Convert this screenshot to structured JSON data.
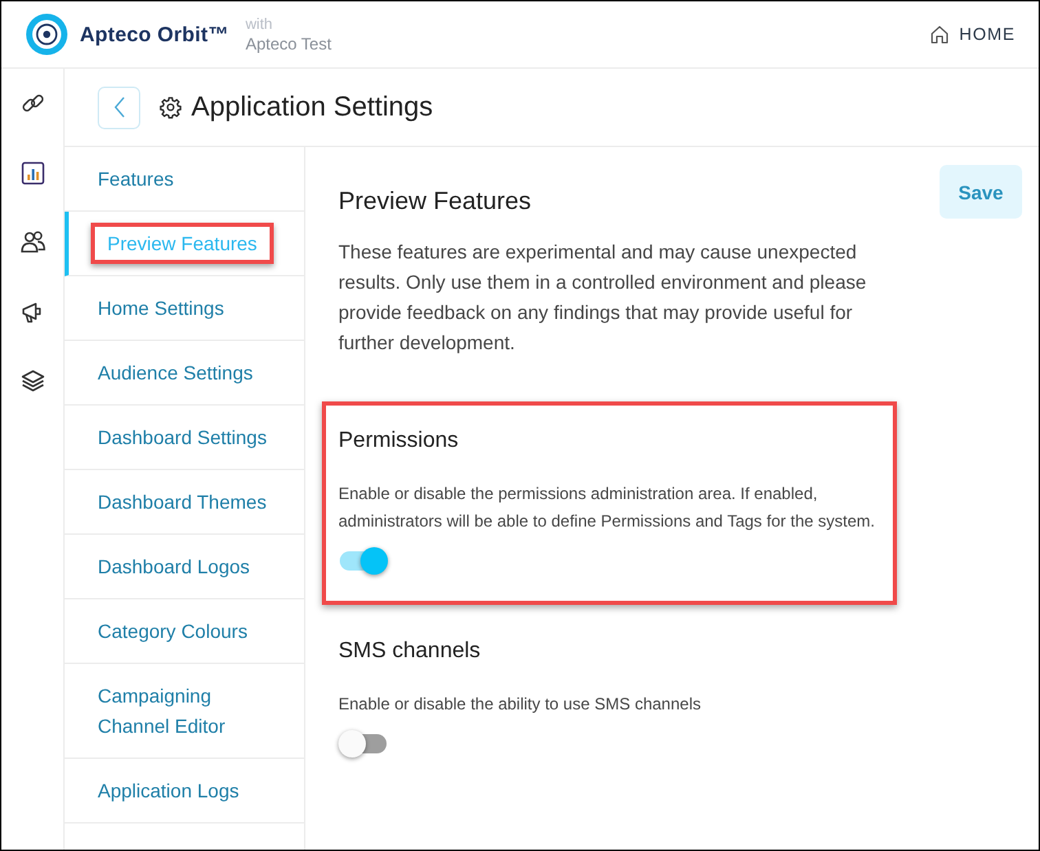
{
  "header": {
    "brand": "Apteco Orbit™",
    "with_label": "with",
    "workspace": "Apteco Test",
    "home_link": "HOME"
  },
  "page_header": {
    "title": "Application Settings"
  },
  "settings_nav": [
    {
      "label": "Features",
      "selected": false,
      "highlighted": false
    },
    {
      "label": "Preview Features",
      "selected": true,
      "highlighted": true
    },
    {
      "label": "Home Settings",
      "selected": false,
      "highlighted": false
    },
    {
      "label": "Audience Settings",
      "selected": false,
      "highlighted": false
    },
    {
      "label": "Dashboard Settings",
      "selected": false,
      "highlighted": false
    },
    {
      "label": "Dashboard Themes",
      "selected": false,
      "highlighted": false
    },
    {
      "label": "Dashboard Logos",
      "selected": false,
      "highlighted": false
    },
    {
      "label": "Category Colours",
      "selected": false,
      "highlighted": false
    },
    {
      "label": "Campaigning Channel Editor",
      "selected": false,
      "highlighted": false
    },
    {
      "label": "Application Logs",
      "selected": false,
      "highlighted": false
    }
  ],
  "content": {
    "title": "Preview Features",
    "description": "These features are experimental and may cause unexpected results. Only use them in a controlled environment and please provide feedback on any findings that may provide useful for further development.",
    "save_button": {
      "label": "Save",
      "disabled": true
    },
    "features": [
      {
        "title": "Permissions",
        "description": "Enable or disable the permissions administration area. If enabled, administrators will be able to define Permissions and Tags for the system.",
        "on": true,
        "highlighted": true
      },
      {
        "title": "SMS channels",
        "description": "Enable or disable the ability to use SMS channels",
        "on": false,
        "highlighted": false
      }
    ]
  }
}
